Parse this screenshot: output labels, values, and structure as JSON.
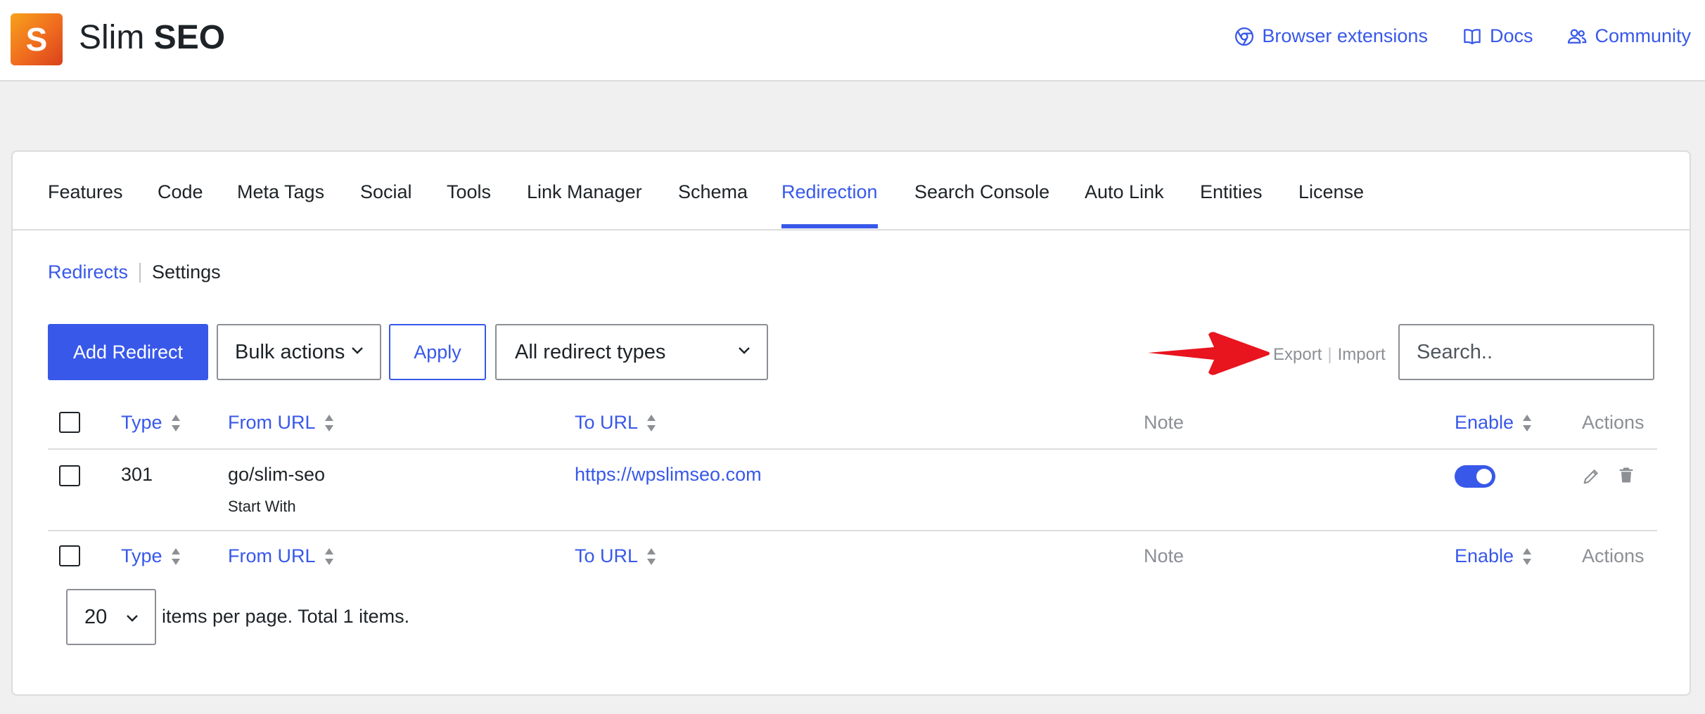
{
  "header": {
    "logo_letter": "S",
    "brand_light": "Slim",
    "brand_bold": "SEO",
    "links": [
      {
        "label": "Browser extensions",
        "icon": "chrome-icon"
      },
      {
        "label": "Docs",
        "icon": "book-icon"
      },
      {
        "label": "Community",
        "icon": "users-icon"
      }
    ]
  },
  "tabs": [
    "Features",
    "Code",
    "Meta Tags",
    "Social",
    "Tools",
    "Link Manager",
    "Schema",
    "Redirection",
    "Search Console",
    "Auto Link",
    "Entities",
    "License"
  ],
  "active_tab": "Redirection",
  "subnav": {
    "redirects": "Redirects",
    "settings": "Settings"
  },
  "toolbar": {
    "add_label": "Add Redirect",
    "bulk_label": "Bulk actions",
    "apply_label": "Apply",
    "types_label": "All redirect types",
    "export_label": "Export",
    "import_label": "Import",
    "search_placeholder": "Search.."
  },
  "table": {
    "columns": {
      "type": "Type",
      "from": "From URL",
      "to": "To URL",
      "note": "Note",
      "enable": "Enable",
      "actions": "Actions"
    },
    "rows": [
      {
        "type": "301",
        "from": "go/slim-seo",
        "match": "Start With",
        "to": "https://wpslimseo.com",
        "note": "",
        "enabled": true
      }
    ]
  },
  "pagination": {
    "per_page": "20",
    "text": "items per page. Total 1 items."
  },
  "colors": {
    "accent": "#3858e9",
    "arrow": "#e8141e"
  }
}
